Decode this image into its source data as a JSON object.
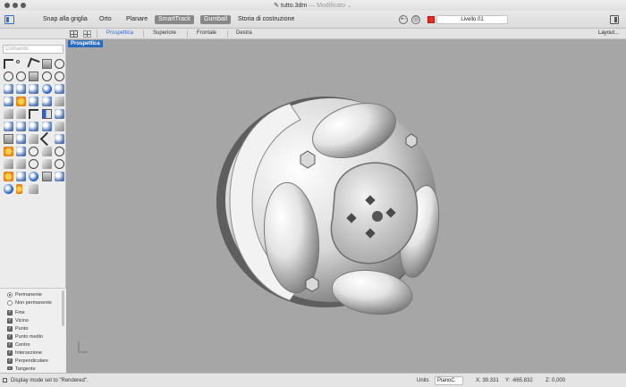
{
  "window": {
    "filename": "tutto.3dm",
    "modified": "— Modificato ⌄"
  },
  "toolbar": {
    "snap_grid": "Snap alla griglia",
    "ortho": "Orto",
    "planar": "Planare",
    "smarttrack": "SmartTrack",
    "gumball": "Gumball",
    "history": "Storia di costruzione",
    "layer_name": "Livello 01",
    "layer_color": "#e52d1e"
  },
  "viewtabs": {
    "items": [
      "Prospettica",
      "Superiore",
      "Frontale",
      "Destra"
    ],
    "active": "Prospettica",
    "layout": "Layout..."
  },
  "command": {
    "placeholder": "Comando"
  },
  "snaps": {
    "mode_permanent": "Permanente",
    "mode_temporary": "Non permanente",
    "items": [
      "Fine",
      "Vicino",
      "Punto",
      "Punto medio",
      "Centro",
      "Intersezione",
      "Perpendicolare",
      "Tangente"
    ]
  },
  "viewport": {
    "label": "Prospettica",
    "background": "#a6a6a6"
  },
  "status": {
    "message": "Display mode set to \"Rendered\".",
    "units_label": "Units",
    "plane": "PianoC",
    "x": "X: 39.331",
    "y": "Y: -665.832",
    "z": "Z: 0,000"
  }
}
